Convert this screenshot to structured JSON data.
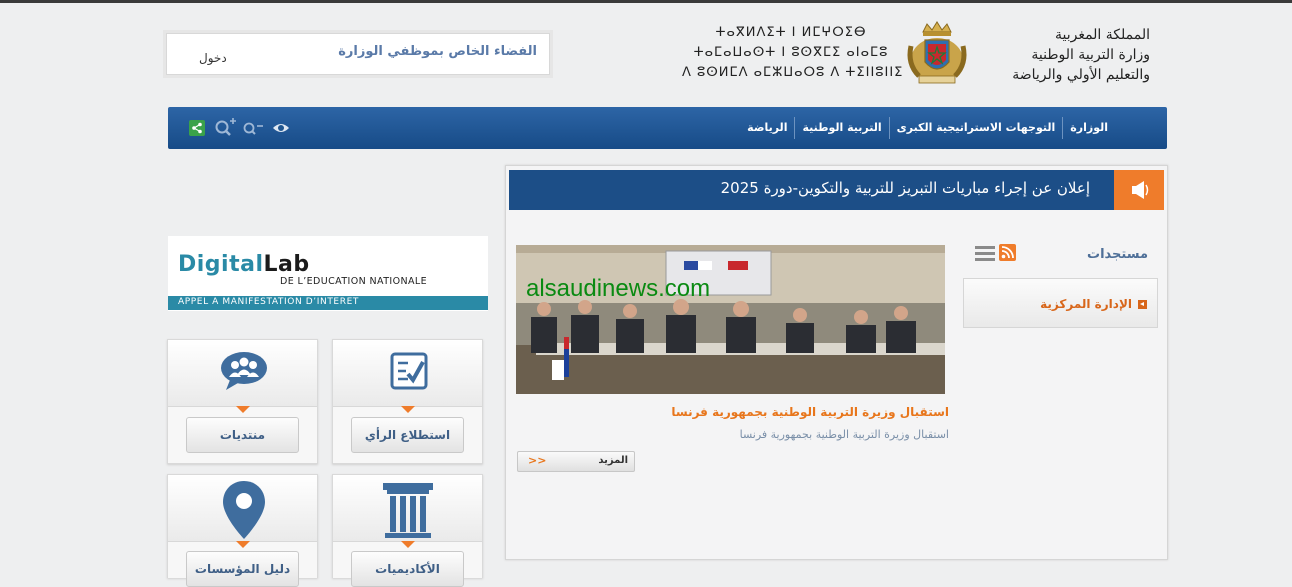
{
  "header": {
    "staff_space_title": "الفضاء الخاص بموظفي الوزارة",
    "login_label": "دخول",
    "ministry_ar": [
      "المملكة المغربية",
      "وزارة التربية الوطنية",
      "والتعليم الأولي والرياضة"
    ],
    "ministry_tifinagh": [
      "ⵜⴰⴳⵍⴷⵉⵜ ⵏ ⵍⵎⵖⵔⵉⴱ",
      "ⵜⴰⵎⴰⵡⴰⵙⵜ ⵏ ⵓⵙⴳⵎⵉ ⴰⵏⴰⵎⵓ",
      "ⴷ ⵓⵙⵍⵎⴷ ⴰⵎⵣⵡⴰⵔⵓ ⴷ ⵜⵉⵏⵏⵓⵏⵏⵉ"
    ]
  },
  "nav": {
    "items": [
      "الوزارة",
      "التوجهات الاستراتيجية الكبرى",
      "التربية الوطنية",
      "الرياضة"
    ],
    "tools": [
      "share-icon",
      "zoom-in-icon",
      "zoom-out-icon",
      "accessibility-eye-icon"
    ]
  },
  "announcement": {
    "text": "إعلان عن إجراء مباريات التبريز للتربية والتكوين-دورة 2025"
  },
  "news": {
    "watermark": "alsaudinews.com",
    "title": "استقبال وزيرة التربية الوطنية بجمهورية فرنسا",
    "description": "استقبال وزيرة التربية الوطنية بجمهورية فرنسا",
    "more_label": "المزيد",
    "more_arrow": ">>"
  },
  "sidebar": {
    "heading": "مستجدات",
    "menu_item": "الإدارة المركزية"
  },
  "banner": {
    "title_part1": "Digital",
    "title_part2": "Lab",
    "subtitle": "DE L’EDUCATION NATIONALE",
    "bar_text": "APPEL A MANIFESTATION D’INTERET"
  },
  "tiles": [
    {
      "label": "استطلاع الرأي",
      "icon": "checklist-icon"
    },
    {
      "label": "منتديات",
      "icon": "users-group-icon"
    },
    {
      "label": "الأكاديميات",
      "icon": "building-columns-icon"
    },
    {
      "label": "دليل المؤسسات",
      "icon": "map-pin-icon"
    }
  ],
  "colors": {
    "nav_blue": "#1f558f",
    "accent_orange": "#ef7c2b",
    "banner_teal": "#2a8aa6"
  }
}
